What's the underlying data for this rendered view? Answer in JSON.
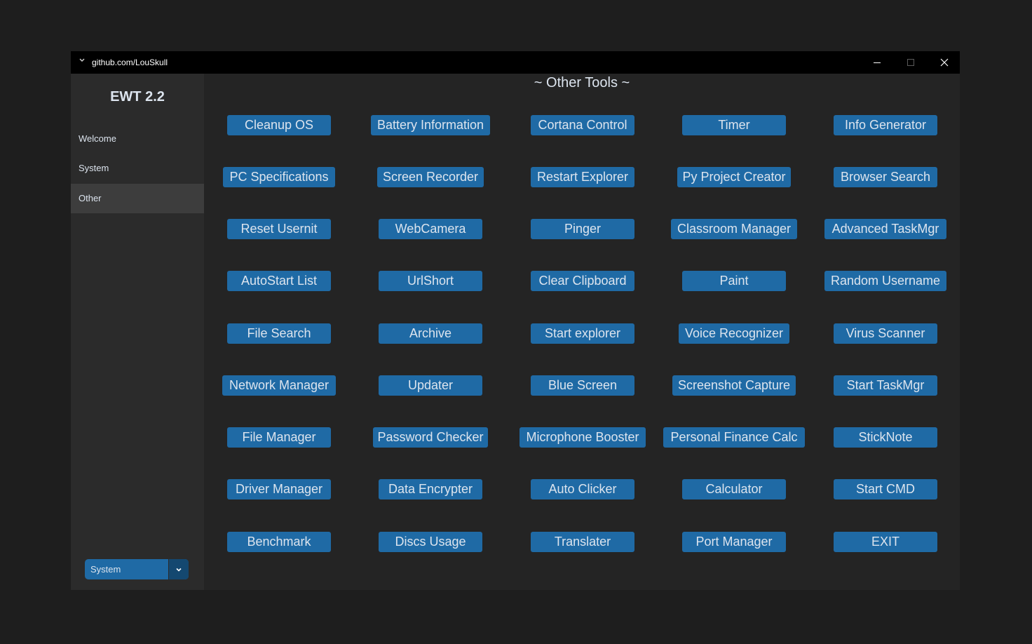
{
  "titlebar": {
    "title": "github.com/LouSkull"
  },
  "sidebar": {
    "logo": "EWT 2.2",
    "items": [
      {
        "label": "Welcome"
      },
      {
        "label": "System"
      },
      {
        "label": "Other"
      }
    ],
    "active_item": "Other",
    "theme_select": {
      "value": "System"
    }
  },
  "main": {
    "title": "~ Other Tools ~",
    "rows": [
      [
        "Cleanup OS",
        "Battery Information",
        "Cortana Control",
        "Timer",
        "Info Generator"
      ],
      [
        "PC Specifications",
        "Screen Recorder",
        "Restart Explorer",
        "Py Project Creator",
        "Browser Search"
      ],
      [
        "Reset Usernit",
        "WebCamera",
        "Pinger",
        "Classroom Manager",
        "Advanced TaskMgr"
      ],
      [
        "AutoStart List",
        "UrlShort",
        "Clear Clipboard",
        "Paint",
        "Random Username"
      ],
      [
        "File Search",
        "Archive",
        "Start explorer",
        "Voice Recognizer",
        "Virus Scanner"
      ],
      [
        "Network Manager",
        "Updater",
        "Blue Screen",
        "Screenshot Capture",
        "Start TaskMgr"
      ],
      [
        "File Manager",
        "Password Checker",
        "Microphone Booster",
        "Personal Finance Calc",
        "StickNote"
      ],
      [
        "Driver Manager",
        "Data Encrypter",
        "Auto Clicker",
        "Calculator",
        "Start CMD"
      ],
      [
        "Benchmark",
        "Discs Usage",
        "Translater",
        "Port Manager",
        "EXIT"
      ]
    ]
  },
  "colors": {
    "button": "#1f6aa5",
    "window_bg": "#242424",
    "sidebar_bg": "#2b2b2b",
    "active_nav": "#3d3d3d",
    "text": "#dce4ee"
  },
  "icons": {
    "app": "chevron-down-icon",
    "minimize": "minimize-icon",
    "maximize": "maximize-icon",
    "close": "close-icon"
  }
}
